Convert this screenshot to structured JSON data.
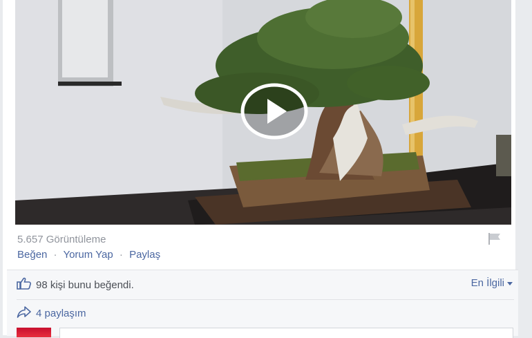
{
  "post": {
    "video": {
      "description_icon": "play-icon"
    },
    "views_text": "5.657 Görüntüleme",
    "actions": {
      "like": "Beğen",
      "comment": "Yorum Yap",
      "share": "Paylaş",
      "separator": "·"
    },
    "feedback": {
      "likes_text": "98 kişi bunu beğendi.",
      "sort_label": "En İlgili",
      "shares_text": "4 paylaşım"
    }
  },
  "colors": {
    "link": "#4b67a1",
    "muted": "#90949c",
    "feedback_bg": "#f6f7f9"
  }
}
